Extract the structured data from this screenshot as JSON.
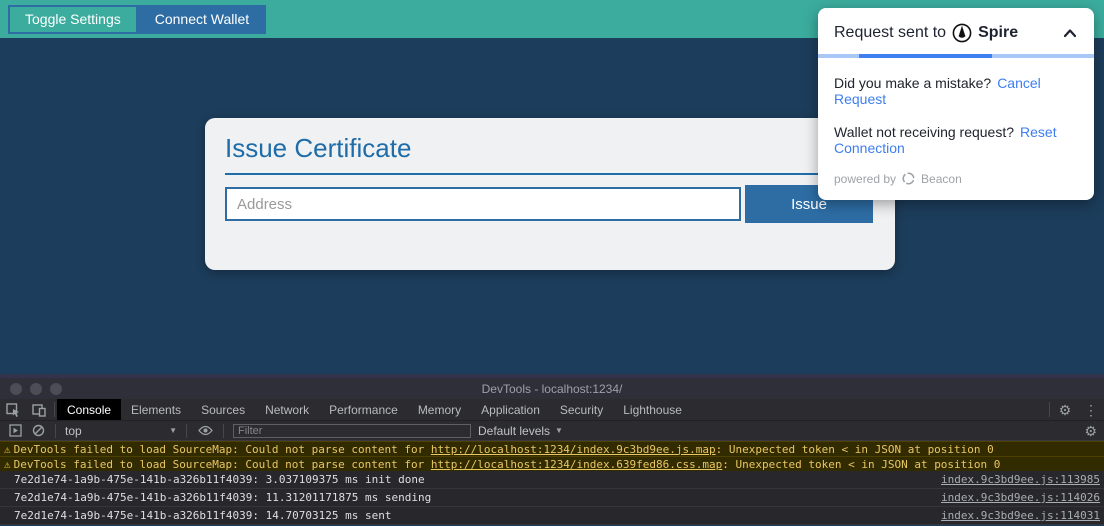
{
  "app": {
    "header": {
      "toggle_settings": "Toggle Settings",
      "connect_wallet": "Connect Wallet"
    },
    "card": {
      "title": "Issue Certificate",
      "address_placeholder": "Address",
      "issue_button": "Issue"
    },
    "modal": {
      "title_prefix": "Request sent to",
      "wallet_name": "Spire",
      "mistake_text": "Did you make a mistake?",
      "cancel_link": "Cancel Request",
      "not_receiving_text": "Wallet not receiving request?",
      "reset_link": "Reset Connection",
      "powered_by": "powered by",
      "beacon_label": "Beacon"
    },
    "colors": {
      "teal": "#3BAC9E",
      "navy": "#1C3D5B",
      "blue": "#2D6DA4",
      "link_blue": "#3D7EF0",
      "progress_light": "#A9C8F8"
    }
  },
  "devtools": {
    "window_title": "DevTools - localhost:1234/",
    "tabs": [
      "Console",
      "Elements",
      "Sources",
      "Network",
      "Performance",
      "Memory",
      "Application",
      "Security",
      "Lighthouse"
    ],
    "active_tab": "Console",
    "toolbar": {
      "context": "top",
      "filter_placeholder": "Filter",
      "levels": "Default levels"
    },
    "console": {
      "warnings": [
        {
          "prefix": "DevTools failed to load SourceMap: Could not parse content for ",
          "link": "http://localhost:1234/index.9c3bd9ee.js.map",
          "suffix": ": Unexpected token < in JSON at position 0"
        },
        {
          "prefix": "DevTools failed to load SourceMap: Could not parse content for ",
          "link": "http://localhost:1234/index.639fed86.css.map",
          "suffix": ": Unexpected token < in JSON at position 0"
        }
      ],
      "logs": [
        {
          "text": "7e2d1e74-1a9b-475e-141b-a326b11f4039: 3.037109375 ms init done",
          "source": "index.9c3bd9ee.js:113985"
        },
        {
          "text": "7e2d1e74-1a9b-475e-141b-a326b11f4039: 11.31201171875 ms sending",
          "source": "index.9c3bd9ee.js:114026"
        },
        {
          "text": "7e2d1e74-1a9b-475e-141b-a326b11f4039: 14.70703125 ms sent",
          "source": "index.9c3bd9ee.js:114031"
        }
      ]
    }
  },
  "icons": {
    "warning": "⚠",
    "gear": "⚙",
    "dots_menu": "⋮",
    "caret_down": "▼"
  }
}
